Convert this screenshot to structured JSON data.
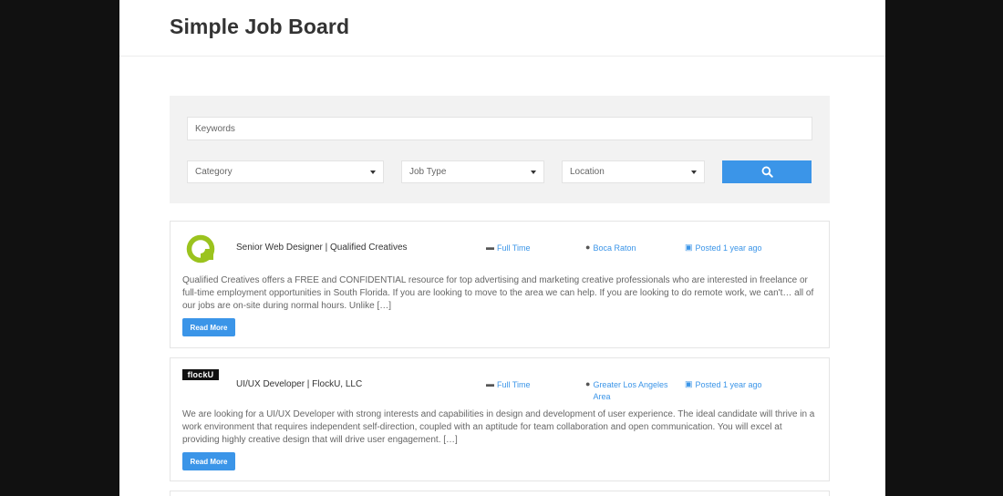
{
  "site": {
    "title": "Simple Job Board"
  },
  "search": {
    "keywords_placeholder": "Keywords",
    "category_label": "Category",
    "job_type_label": "Job Type",
    "location_label": "Location"
  },
  "colors": {
    "accent": "#3b95e8",
    "logo_green": "#9bc31e"
  },
  "jobs": [
    {
      "title": "Senior Web Designer | Qualified Creatives",
      "type": "Full Time",
      "location": "Boca Raton",
      "posted": "Posted 1 year ago",
      "description": "Qualified Creatives offers a FREE and CONFIDENTIAL resource for top advertising and marketing creative professionals who are interested in freelance or full-time employment opportunities in South Florida. If you are looking to move to the area we can help. If you are looking to do remote work, we can't… all of our jobs are on-site during normal hours. Unlike […]",
      "button": "Read More"
    },
    {
      "title": "UI/UX Developer | FlockU, LLC",
      "type": "Full Time",
      "location": "Greater Los Angeles Area",
      "posted": "Posted 1 year ago",
      "logo_text": "flockU",
      "description": "We are looking for a UI/UX Developer with strong interests and capabilities in design and development of user experience.  The ideal candidate will thrive in a work environment that requires independent self-direction, coupled with an aptitude for team collaboration and open communication.  You will excel at providing highly creative design that will drive user engagement.  […]",
      "button": "Read More"
    }
  ]
}
